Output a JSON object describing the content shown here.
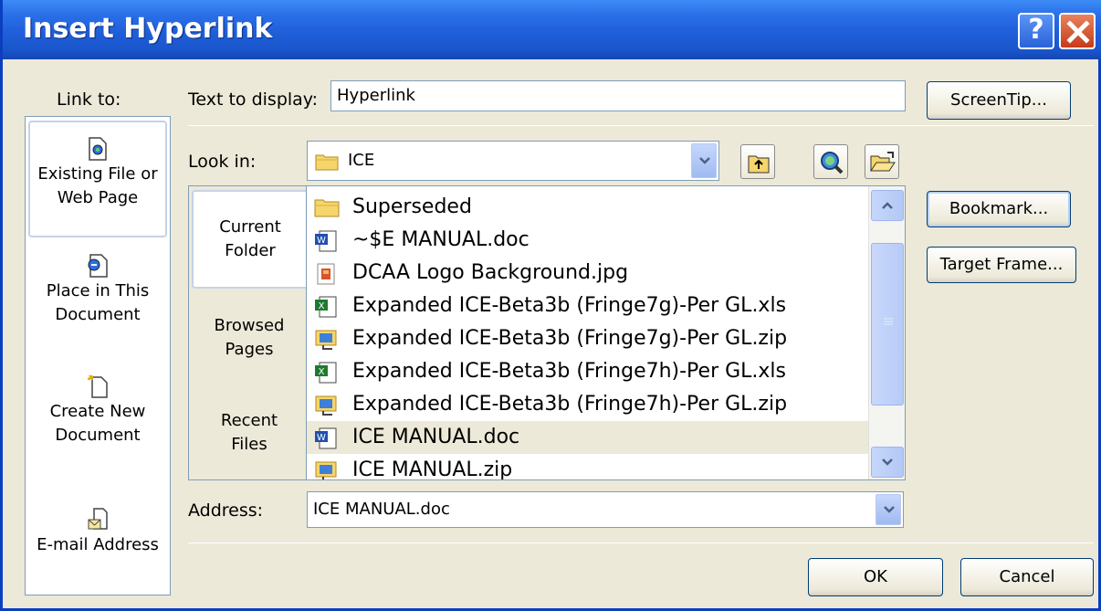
{
  "window": {
    "title": "Insert Hyperlink",
    "help_label": "?",
    "accent": "#1f5fd9"
  },
  "link_to": {
    "header": "Link to:",
    "items": [
      {
        "label_line1": "Existing File or",
        "label_line2": "Web Page",
        "icon": "existing-file-icon",
        "selected": true
      },
      {
        "label_line1": "Place in This",
        "label_line2": "Document",
        "icon": "place-in-document-icon",
        "selected": false
      },
      {
        "label_line1": "Create New",
        "label_line2": "Document",
        "icon": "create-new-document-icon",
        "selected": false
      },
      {
        "label_line1": "E-mail Address",
        "label_line2": "",
        "icon": "email-address-icon",
        "selected": false
      }
    ]
  },
  "text_to_display": {
    "label": "Text to display:",
    "value": "Hyperlink"
  },
  "screentip_button": "ScreenTip...",
  "look_in": {
    "label": "Look in:",
    "value": "ICE"
  },
  "nav_tabs": [
    {
      "line1": "Current",
      "line2": "Folder",
      "selected": true
    },
    {
      "line1": "Browsed",
      "line2": "Pages",
      "selected": false
    },
    {
      "line1": "Recent",
      "line2": "Files",
      "selected": false
    }
  ],
  "files": [
    {
      "name": "Superseded",
      "type": "folder"
    },
    {
      "name": "~$E MANUAL.doc",
      "type": "doc"
    },
    {
      "name": "DCAA Logo Background.jpg",
      "type": "jpg"
    },
    {
      "name": "Expanded ICE-Beta3b (Fringe7g)-Per GL.xls",
      "type": "xls"
    },
    {
      "name": "Expanded ICE-Beta3b (Fringe7g)-Per GL.zip",
      "type": "zip"
    },
    {
      "name": "Expanded ICE-Beta3b (Fringe7h)-Per GL.xls",
      "type": "xls"
    },
    {
      "name": "Expanded ICE-Beta3b (Fringe7h)-Per GL.zip",
      "type": "zip"
    },
    {
      "name": "ICE MANUAL.doc",
      "type": "doc",
      "highlighted": true
    },
    {
      "name": "ICE MANUAL.zip",
      "type": "zip"
    }
  ],
  "bookmark_button": "Bookmark...",
  "target_frame_button": "Target Frame...",
  "address": {
    "label": "Address:",
    "value": "ICE MANUAL.doc"
  },
  "ok_button": "OK",
  "cancel_button": "Cancel"
}
